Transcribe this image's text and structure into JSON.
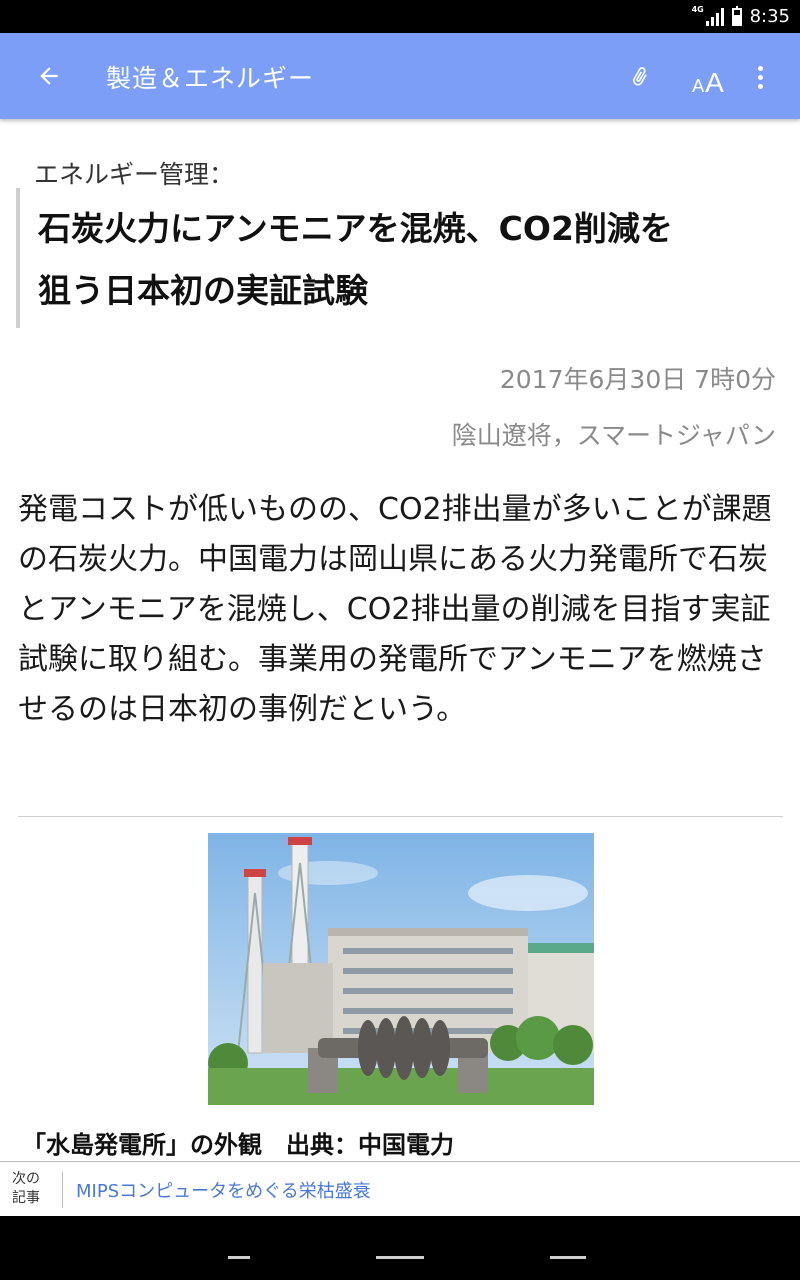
{
  "status_bar": {
    "network": "4G",
    "time": "8:35"
  },
  "app_bar": {
    "title": "製造＆エネルギー",
    "font_size_small": "A",
    "font_size_large": "A"
  },
  "article": {
    "kicker": "エネルギー管理：",
    "headline_line1": "石炭火力にアンモニアを混焼、CO2削減を",
    "headline_line2": "狙う日本初の実証試験",
    "date": "2017年6月30日 7時0分",
    "author": "陰山遼将，スマートジャパン",
    "body": "発電コストが低いものの、CO2排出量が多いことが課題の石炭火力。中国電力は岡山県にある火力発電所で石炭とアンモニアを混焼し、CO2排出量の削減を目指す実証試験に取り組む。事業用の発電所でアンモニアを燃焼させるのは日本初の事例だという。",
    "photo_caption": "「水島発電所」の外観　出典：中国電力"
  },
  "next_article": {
    "label_line1": "次の",
    "label_line2": "記事",
    "title": "MIPSコンピュータをめぐる栄枯盛衰"
  },
  "colors": {
    "app_bar": "#7c9ef6",
    "link": "#4a78d8",
    "meta_text": "#8a8a8a"
  }
}
